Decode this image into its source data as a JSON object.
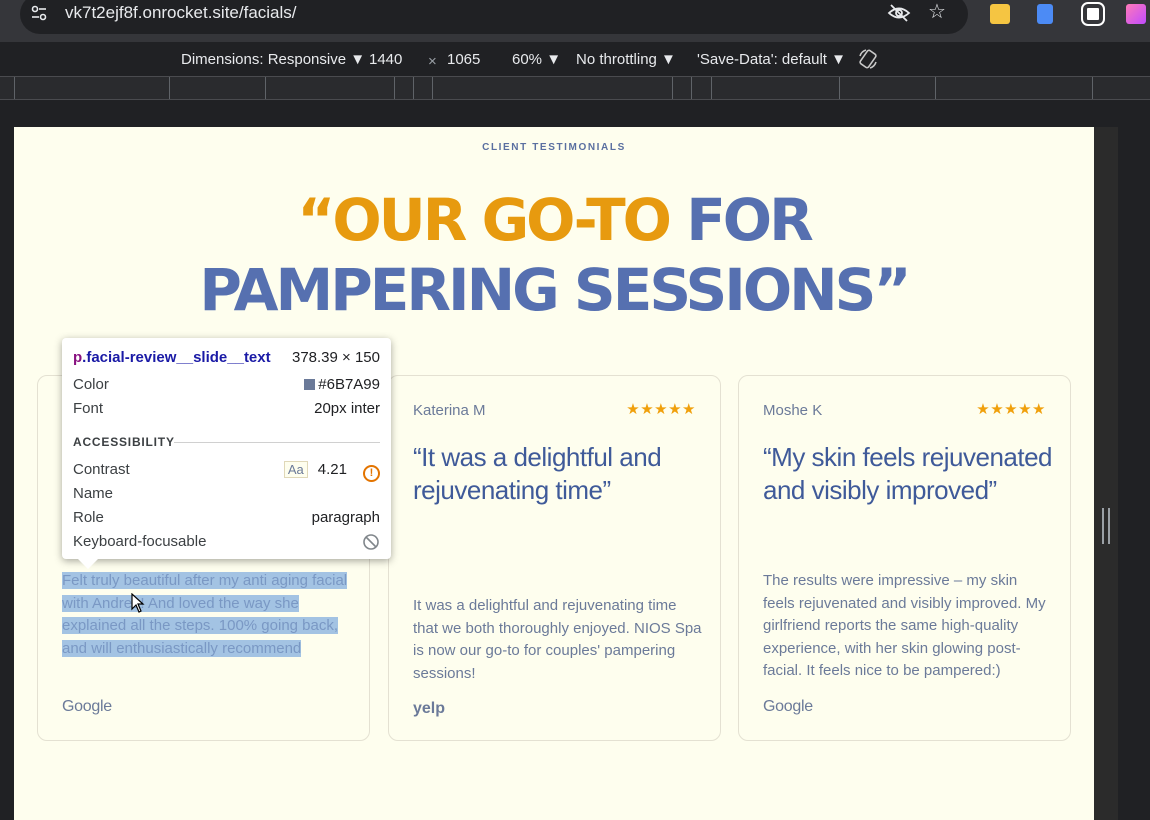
{
  "browser": {
    "url": "vk7t2ejf8f.onrocket.site/facials/",
    "icons": [
      "site-settings-icon",
      "eye-off-icon",
      "star-icon",
      "extension-icons"
    ]
  },
  "device_toolbar": {
    "dimensions_label": "Dimensions: Responsive ▼",
    "width": "1440",
    "times": "×",
    "height": "1065",
    "zoom": "60% ▼",
    "throttling": "No throttling ▼",
    "save_data": "'Save-Data': default ▼"
  },
  "page": {
    "eyebrow": "CLIENT TESTIMONIALS",
    "headline_gold": "“OUR GO-TO",
    "headline_blue_1": "FOR",
    "headline_blue_2": "PAMPERING SESSIONS”",
    "accent_gold": "#E79A0F",
    "accent_blue": "#5670B0",
    "cards": [
      {
        "author": "",
        "stars": "",
        "quote": "",
        "body": "Felt truly beautiful after my anti aging facial with Andrea! And loved the way she explained all the steps. 100% going back, and will enthusiastically recommend",
        "source": "Google"
      },
      {
        "author": "Katerina M",
        "stars": "★★★★★",
        "quote": "“It was a delightful and rejuvenating time”",
        "body": "It was a delightful and rejuvenating time that we both thoroughly enjoyed. NIOS Spa is now our go-to for couples' pampering sessions!",
        "source": "yelp"
      },
      {
        "author": "Moshe K",
        "stars": "★★★★★",
        "quote": "“My skin feels rejuvenated and visibly improved”",
        "body": "The results were impressive – my skin feels rejuvenated and visibly improved. My girlfriend reports the same high-quality experience, with her skin glowing post-facial. It feels nice to be pampered:)",
        "source": "Google"
      }
    ]
  },
  "inspector": {
    "selector_tag": "p",
    "selector_class": ".facial-review__slide__text",
    "size": "378.39 × 150",
    "color_label": "Color",
    "color_value": "#6B7A99",
    "font_label": "Font",
    "font_value": "20px inter",
    "section": "ACCESSIBILITY",
    "contrast_label": "Contrast",
    "contrast_sample": "Aa",
    "contrast_value": "4.21",
    "name_label": "Name",
    "role_label": "Role",
    "role_value": "paragraph",
    "focusable_label": "Keyboard-focusable"
  }
}
